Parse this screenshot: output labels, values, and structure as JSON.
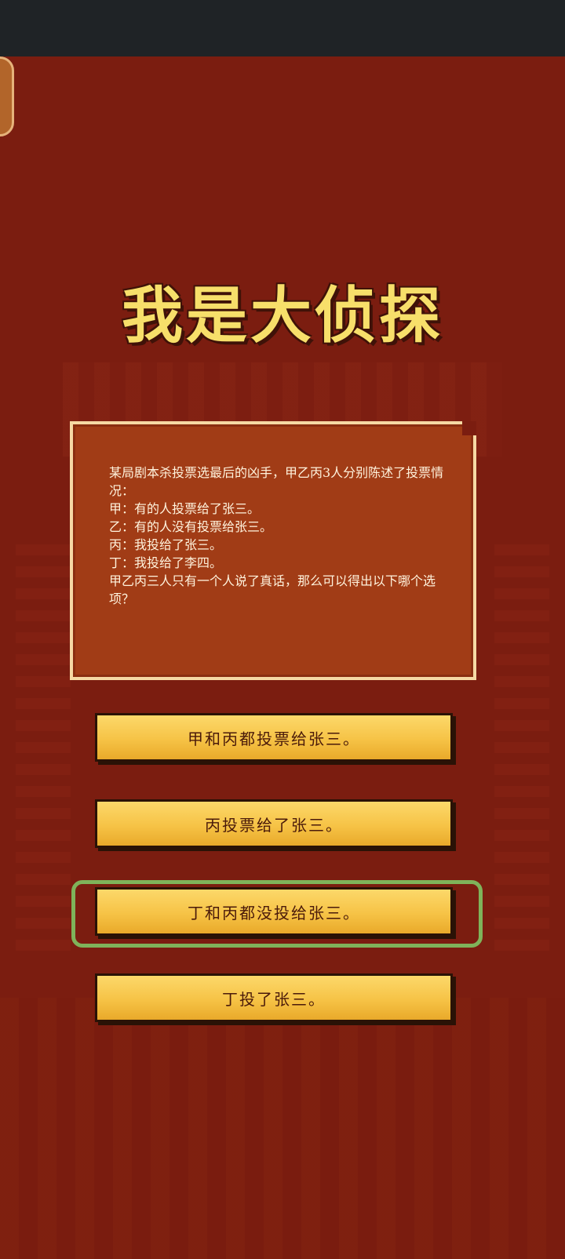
{
  "game": {
    "title": "我是大侦探",
    "question": "某局剧本杀投票选最后的凶手，甲乙丙3人分别陈述了投票情况：\n甲：有的人投票给了张三。\n乙：有的人没有投票给张三。\n丙：我投给了张三。\n丁：我投给了李四。\n甲乙丙三人只有一个人说了真话，那么可以得出以下哪个选项？",
    "options": [
      {
        "label": "甲和丙都投票给张三。"
      },
      {
        "label": "丙投票给了张三。"
      },
      {
        "label": "丁和丙都没投给张三。",
        "highlighted": true
      },
      {
        "label": "丁投了张三。"
      }
    ],
    "colors": {
      "background": "#7b1d10",
      "title": "#f7df6a",
      "card": "#a13c16",
      "card_border": "#f6d9a4",
      "button": "#f6c346",
      "highlight": "#7fb35a"
    }
  }
}
